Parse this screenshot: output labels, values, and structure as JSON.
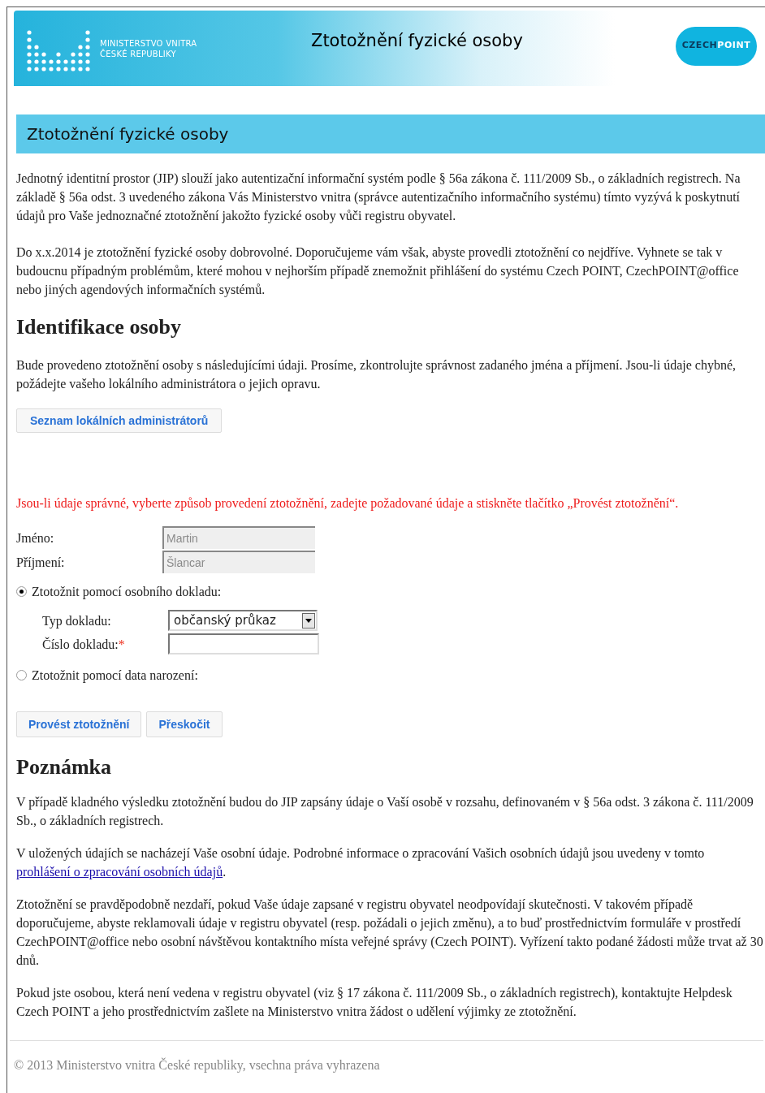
{
  "header": {
    "ministry_line_1": "MINISTERSTVO VNITRA",
    "ministry_line_2": "ČESKÉ REPUBLIKY",
    "title": "Ztotožnění fyzické osoby",
    "badge_part_1": "CZECH",
    "badge_part_2": "POINT"
  },
  "section_title": "Ztotožnění fyzické osoby",
  "intro": [
    "Jednotný identitní prostor (JIP) slouží jako autentizační informační systém podle § 56a zákona č. 111/2009 Sb., o základních registrech. Na základě § 56a odst. 3 uvedeného zákona Vás Ministerstvo vnitra (správce autentizačního informačního systému) tímto vyzývá k poskytnutí údajů pro Vaše jednoznačné ztotožnění jakožto fyzické osoby vůči registru obyvatel.",
    "Do x.x.2014 je ztotožnění fyzické osoby dobrovolné. Doporučujeme vám však, abyste provedli ztotožnění co nejdříve. Vyhnete se tak v budoucnu případným problémům, které mohou v nejhorším případě znemožnit přihlášení do systému Czech POINT, CzechPOINT@office nebo jiných agendových informačních systémů."
  ],
  "identification": {
    "heading": "Identifikace osoby",
    "text": "Bude provedeno ztotožnění osoby s následujícími údaji. Prosíme, zkontrolujte správnost zadaného jména a příjmení. Jsou-li údaje chybné, požádejte vašeho lokálního administrátora o jejich opravu.",
    "admin_button": "Seznam lokálních administrátorů"
  },
  "instruction": "Jsou-li údaje správné, vyberte způsob provedení ztotožnění, zadejte požadované údaje a stiskněte tlačítko „Provést ztotožnění“.",
  "person_fields": [
    {
      "label": "Jméno:",
      "value": "Martin",
      "disabled": true
    },
    {
      "label": "Příjmení:",
      "value": "Šlancar",
      "disabled": true
    }
  ],
  "methods": [
    {
      "label": "Ztotožnit pomocí osobního dokladu:",
      "selected": true,
      "fields": [
        {
          "kind": "select",
          "label": "Typ dokladu:",
          "value": "občanský průkaz"
        },
        {
          "kind": "input",
          "label": "Číslo dokladu:",
          "required_mark": "*"
        }
      ]
    },
    {
      "label": "Ztotožnit pomocí data narození:",
      "selected": false
    }
  ],
  "buttons": [
    "Provést ztotožnění",
    "Přeskočit"
  ],
  "note": {
    "heading": "Poznámka",
    "paragraphs": [
      [
        {
          "kind": "text",
          "text": "V případě kladného výsledku ztotožnění budou do JIP zapsány údaje o Vaší osobě v rozsahu, definovaném v § 56a odst. 3 zákona č. 111/2009 Sb., o základních registrech."
        }
      ],
      [
        {
          "kind": "text",
          "text": "V uložených údajích se nacházejí Vaše osobní údaje. Podrobné informace o zpracování Vašich osobních údajů jsou uvedeny v tomto "
        },
        {
          "kind": "link",
          "text": "prohlášení o zpracování osobních údajů"
        },
        {
          "kind": "text",
          "text": "."
        }
      ],
      [
        {
          "kind": "text",
          "text": "Ztotožnění se pravděpodobně nezdaří, pokud Vaše údaje zapsané v registru obyvatel neodpovídají skutečnosti. V takovém případě doporučujeme, abyste reklamovali údaje v registru obyvatel (resp. požádali o jejich změnu), a to buď prostřednictvím formuláře v prostředí CzechPOINT@office nebo osobní návštěvou kontaktního místa veřejné správy (Czech POINT). Vyřízení takto podané žádosti může trvat až 30 dnů."
        }
      ],
      [
        {
          "kind": "text",
          "text": "Pokud jste osobou, která není vedena v registru obyvatel (viz § 17 zákona č. 111/2009 Sb., o základních registrech), kontaktujte Helpdesk Czech POINT a jeho prostřednictvím zašlete na Ministerstvo vnitra žádost o udělení výjimky ze ztotožnění."
        }
      ]
    ]
  },
  "footer": "© 2013 Ministerstvo vnitra České republiky, vsechna práva vyhrazena"
}
